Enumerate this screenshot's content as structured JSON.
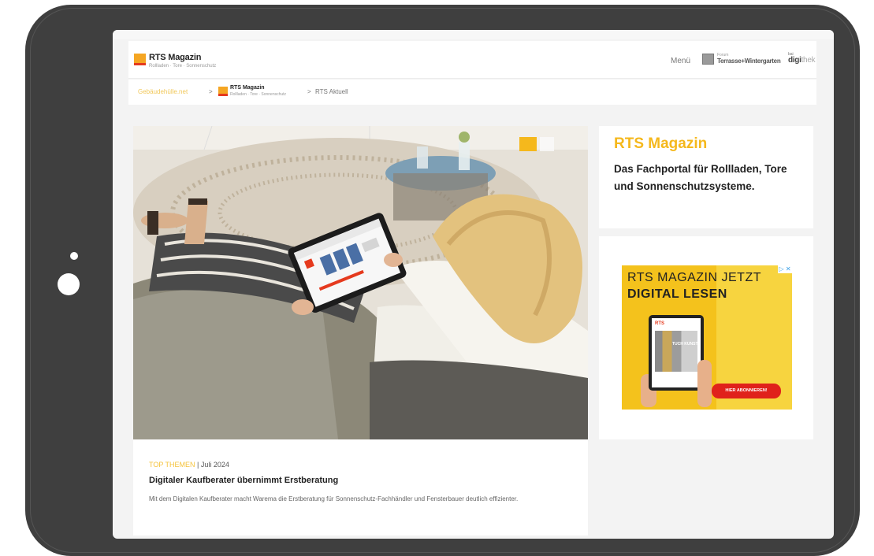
{
  "header": {
    "logo_title": "RTS Magazin",
    "logo_subtitle": "Rollladen · Tore · Sonnenschutz",
    "menu_label": "Menü",
    "forum_small": "Forum",
    "forum_label": "Terrasse+Wintergarten",
    "digi_small": "bai",
    "digi_bold": "digi",
    "digi_light": "thek"
  },
  "breadcrumb": {
    "home": "Gebäudehülle.net",
    "sep1": ">",
    "logo_title": "RTS Magazin",
    "logo_subtitle": "Rollladen · Tore · Sonnenschutz",
    "sep2": ">",
    "current": "RTS Aktuell"
  },
  "article": {
    "category": "TOP THEMEN",
    "date": "| Juli 2024",
    "title": "Digitaler Kaufberater übernimmt Erstberatung",
    "teaser": "Mit dem Digitalen Kaufberater macht Warema die Erstberatung für Sonnenschutz-Fachhändler und Fensterbauer deutlich effizienter."
  },
  "sidebar": {
    "title": "RTS Magazin",
    "description": "Das Fachportal für Rollladen, Tore und Sonnenschutzsysteme."
  },
  "ad": {
    "line1": "RTS MAGAZIN JETZT",
    "line2": "DIGITAL LESEN",
    "choices": "▷ ✕",
    "mag_logo": "RTS",
    "mag_word": "TUCH KUNST",
    "cta": "HIER ABONNIEREN!"
  },
  "colors": {
    "accent": "#f5b81c",
    "logo_orange": "#f5a623",
    "logo_red": "#e53a1e",
    "tablet_frame": "#3f3f3f",
    "ad_yellow": "#f4c21c",
    "ad_cta": "#e0221b"
  }
}
